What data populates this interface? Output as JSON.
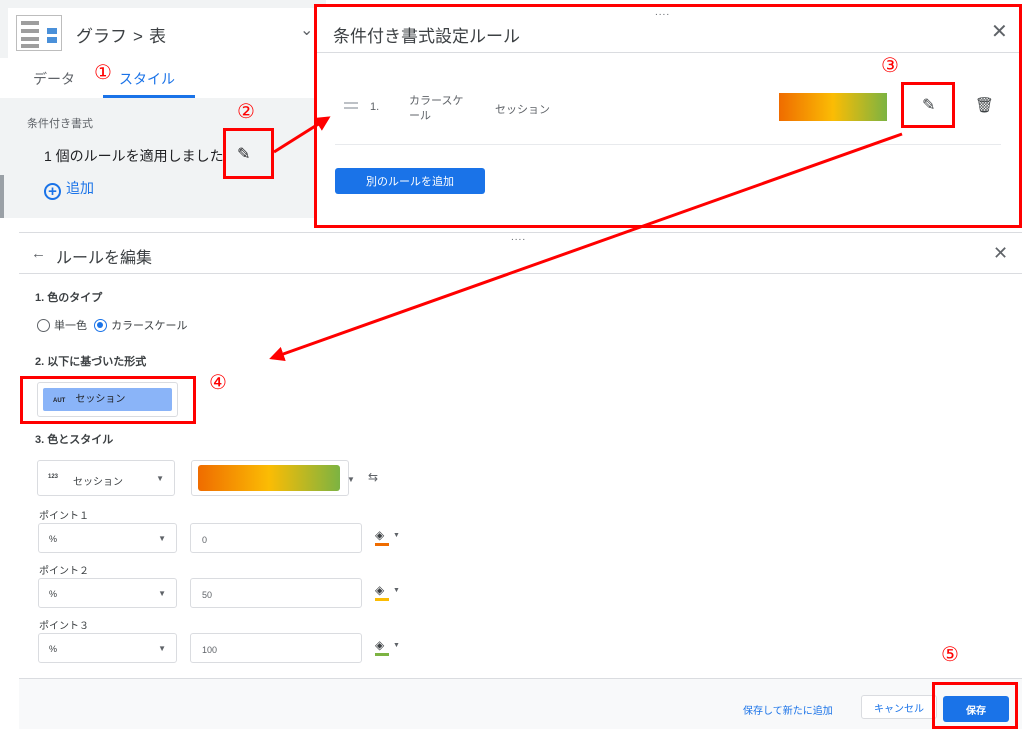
{
  "left_panel": {
    "title": {
      "chart": "グラフ",
      "separator": ">",
      "component": "表"
    },
    "chevron": "⌄",
    "tabs": [
      {
        "label": "データ"
      },
      {
        "label": "スタイル"
      }
    ],
    "section_label": "条件付き書式",
    "rule_applied_text": "1 個のルールを適用しました",
    "add_label": "追加",
    "add_icon": "+"
  },
  "rules_dialog": {
    "grip": "....",
    "title": "条件付き書式設定ルール",
    "close": "✕",
    "rule": {
      "number": "1.",
      "type": "カラースケール",
      "field": "セッション",
      "gradient_colors": [
        "#ef6c00",
        "#fbbc04",
        "#7cb342"
      ]
    },
    "add_another_rule_label": "別のルールを追加"
  },
  "edit_panel": {
    "grip": "....",
    "back": "←",
    "title": "ルールを編集",
    "close": "✕",
    "sections": {
      "color_type": "1. 色のタイプ",
      "based_on": "2. 以下に基づいた形式",
      "color_and_style": "3. 色とスタイル"
    },
    "color_type_options": [
      {
        "label": "単一色",
        "selected": false
      },
      {
        "label": "カラースケール",
        "selected": true
      }
    ],
    "based_on_metric": {
      "tag": "AUT",
      "label": "セッション"
    },
    "color_field": {
      "tag": "123",
      "label": "セッション"
    },
    "scale_colors": [
      "#ef6c00",
      "#fbbc04",
      "#7cb342"
    ],
    "points": [
      {
        "label": "ポイント１",
        "type": "%",
        "value": "0",
        "color": "#ef6c00"
      },
      {
        "label": "ポイント２",
        "type": "%",
        "value": "50",
        "color": "#fbbc04"
      },
      {
        "label": "ポイント３",
        "type": "%",
        "value": "100",
        "color": "#7cb342"
      }
    ],
    "footer": {
      "save_and_add": "保存して新たに追加",
      "cancel": "キャンセル",
      "save": "保存"
    }
  },
  "annotations": {
    "accent_color": "#ff0000",
    "markers": [
      "①",
      "②",
      "③",
      "④",
      "⑤"
    ]
  }
}
